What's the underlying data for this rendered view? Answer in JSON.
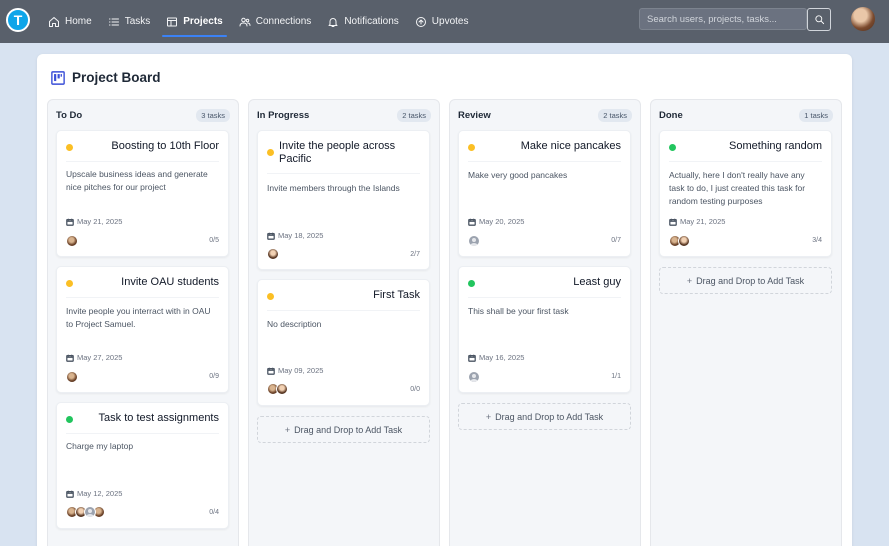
{
  "brand": {
    "logo_letter": "T"
  },
  "nav": {
    "items": [
      {
        "label": "Home",
        "icon": "home-icon"
      },
      {
        "label": "Tasks",
        "icon": "list-icon"
      },
      {
        "label": "Projects",
        "icon": "board-icon",
        "active": true
      },
      {
        "label": "Connections",
        "icon": "users-icon"
      },
      {
        "label": "Notifications",
        "icon": "bell-icon"
      },
      {
        "label": "Upvotes",
        "icon": "upvote-icon"
      }
    ],
    "search_placeholder": "Search users, projects, tasks..."
  },
  "board": {
    "title": "Project Board",
    "drop_label": "Drag and Drop to Add Task",
    "columns": [
      {
        "name": "To Do",
        "count": "3 tasks",
        "cards": [
          {
            "title": "Boosting to 10th Floor",
            "status": "yellow",
            "description": "Upscale business ideas and generate nice pitches for our project",
            "date": "May 21, 2025",
            "progress": "0/5"
          },
          {
            "title": "Invite OAU students",
            "status": "yellow",
            "description": "Invite people you interract with in OAU to Project Samuel.",
            "date": "May 27, 2025",
            "progress": "0/9"
          },
          {
            "title": "Task to test assignments",
            "status": "green",
            "description": "Charge my laptop",
            "date": "May 12, 2025",
            "progress": "0/4"
          }
        ]
      },
      {
        "name": "In Progress",
        "count": "2 tasks",
        "cards": [
          {
            "title": "Invite the people across Pacific",
            "status": "yellow",
            "description": "Invite members through the Islands",
            "date": "May 18, 2025",
            "progress": "2/7"
          },
          {
            "title": "First Task",
            "status": "yellow",
            "description": "No description",
            "date": "May 09, 2025",
            "progress": "0/0"
          }
        ]
      },
      {
        "name": "Review",
        "count": "2 tasks",
        "cards": [
          {
            "title": "Make nice pancakes",
            "status": "yellow",
            "description": "Make very good pancakes",
            "date": "May 20, 2025",
            "progress": "0/7"
          },
          {
            "title": "Least guy",
            "status": "green",
            "description": "This shall be your first task",
            "date": "May 16, 2025",
            "progress": "1/1"
          }
        ]
      },
      {
        "name": "Done",
        "count": "1 tasks",
        "cards": [
          {
            "title": "Something random",
            "status": "green",
            "description": "Actually, here I don't really have any task to do, I just created this task for random testing purposes",
            "date": "May 21, 2025",
            "progress": "3/4"
          }
        ]
      }
    ]
  },
  "colors": {
    "yellow": "#fbbf24",
    "green": "#22c55e",
    "navbar": "#59606b",
    "accent": "#3b82f6"
  }
}
